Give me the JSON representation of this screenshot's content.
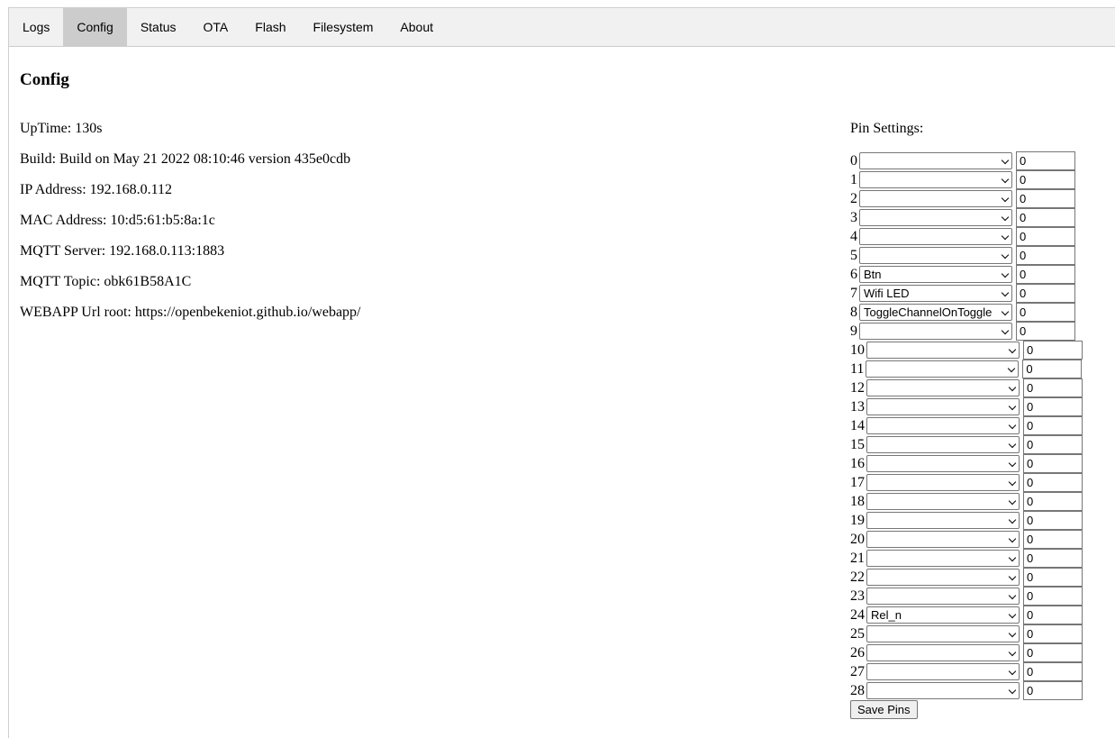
{
  "tabs": [
    "Logs",
    "Config",
    "Status",
    "OTA",
    "Flash",
    "Filesystem",
    "About"
  ],
  "active_tab": "Config",
  "page_title": "Config",
  "info": [
    "UpTime: 130s",
    "Build: Build on May 21 2022 08:10:46 version 435e0cdb",
    "IP Address: 192.168.0.112",
    "MAC Address: 10:d5:61:b5:8a:1c",
    "MQTT Server: 192.168.0.113:1883",
    "MQTT Topic: obk61B58A1C",
    "WEBAPP Url root: https://openbekeniot.github.io/webapp/"
  ],
  "pins_title": "Pin Settings:",
  "pins": [
    {
      "num": "0",
      "role": "",
      "channel": "0"
    },
    {
      "num": "1",
      "role": "",
      "channel": "0"
    },
    {
      "num": "2",
      "role": "",
      "channel": "0"
    },
    {
      "num": "3",
      "role": "",
      "channel": "0"
    },
    {
      "num": "4",
      "role": "",
      "channel": "0"
    },
    {
      "num": "5",
      "role": "",
      "channel": "0"
    },
    {
      "num": "6",
      "role": "Btn",
      "channel": "0"
    },
    {
      "num": "7",
      "role": "Wifi LED",
      "channel": "0"
    },
    {
      "num": "8",
      "role": "ToggleChannelOnToggle",
      "channel": "0"
    },
    {
      "num": "9",
      "role": "",
      "channel": "0"
    },
    {
      "num": "10",
      "role": "",
      "channel": "0"
    },
    {
      "num": "11",
      "role": "",
      "channel": "0"
    },
    {
      "num": "12",
      "role": "",
      "channel": "0"
    },
    {
      "num": "13",
      "role": "",
      "channel": "0"
    },
    {
      "num": "14",
      "role": "",
      "channel": "0"
    },
    {
      "num": "15",
      "role": "",
      "channel": "0"
    },
    {
      "num": "16",
      "role": "",
      "channel": "0"
    },
    {
      "num": "17",
      "role": "",
      "channel": "0"
    },
    {
      "num": "18",
      "role": "",
      "channel": "0"
    },
    {
      "num": "19",
      "role": "",
      "channel": "0"
    },
    {
      "num": "20",
      "role": "",
      "channel": "0"
    },
    {
      "num": "21",
      "role": "",
      "channel": "0"
    },
    {
      "num": "22",
      "role": "",
      "channel": "0"
    },
    {
      "num": "23",
      "role": "",
      "channel": "0"
    },
    {
      "num": "24",
      "role": "Rel_n",
      "channel": "0"
    },
    {
      "num": "25",
      "role": "",
      "channel": "0"
    },
    {
      "num": "26",
      "role": "",
      "channel": "0"
    },
    {
      "num": "27",
      "role": "",
      "channel": "0"
    },
    {
      "num": "28",
      "role": "",
      "channel": "0"
    }
  ],
  "save_label": "Save Pins"
}
